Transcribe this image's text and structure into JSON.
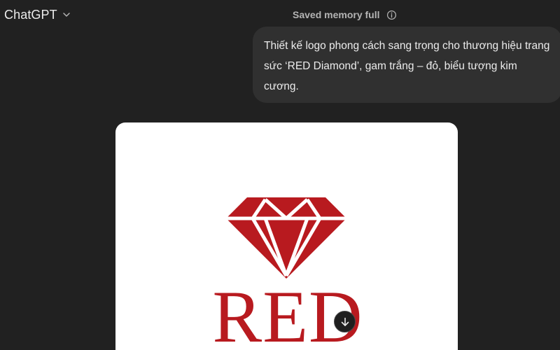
{
  "header": {
    "model_label": "ChatGPT",
    "memory_status": "Saved memory full"
  },
  "conversation": {
    "user_message": "Thiết kế logo phong cách sang trọng cho thương hiệu trang sức ‘RED Diamond’, gam trắng – đỏ, biểu tượng kim cương."
  },
  "generated_image": {
    "logo_text": "RED",
    "brand_color": "#b81a1f",
    "background_color": "#ffffff",
    "icon": "diamond-icon"
  },
  "icons": {
    "model_dropdown": "chevron-down-icon",
    "memory_info": "info-icon",
    "scroll": "arrow-down-icon"
  },
  "theme": {
    "app_background": "#212121",
    "bubble_background": "#303030",
    "text_primary": "#ececec",
    "text_secondary": "#b4b4b4"
  }
}
